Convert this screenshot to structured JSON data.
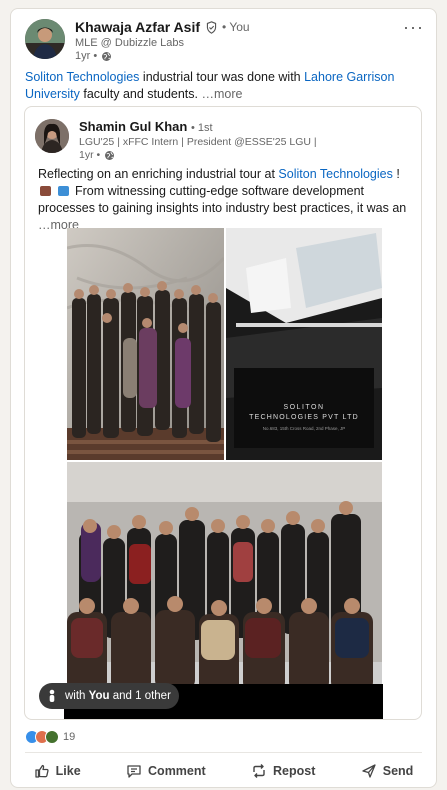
{
  "author": {
    "name": "Khawaja Azfar Asif",
    "you_label": "• You",
    "headline": "MLE @ Dubizzle Labs",
    "time": "1yr •"
  },
  "post": {
    "link1": "Soliton Technologies",
    "text1": " industrial tour was done with ",
    "link2": "Lahore Garrison University",
    "text2": " faculty and students.",
    "more": "…more"
  },
  "shared": {
    "name": "Shamin Gul Khan",
    "degree": "• 1st",
    "headline": "LGU'25 | xFFC Intern | President @ESSE'25 LGU |",
    "time": "1yr •",
    "text_a": "Reflecting on an enriching industrial tour at ",
    "link": "Soliton Technologies",
    "text_b": " ! ",
    "text_c": " From witnessing cutting-edge software development processes to gaining insights into industry best practices, it was an ",
    "more": "…more",
    "sign_line1": "SOLITON",
    "sign_line2": "TECHNOLOGIES PVT LTD",
    "sign_line3": "No.683, 15th Cross Road, 2nd Phase, JP",
    "tag_with": "with ",
    "tag_you": "You",
    "tag_rest": " and 1 other"
  },
  "reactions": {
    "count": "19"
  },
  "actions": {
    "like": "Like",
    "comment": "Comment",
    "repost": "Repost",
    "send": "Send"
  },
  "colors": {
    "link": "#0a66c2",
    "like": "#378fe9",
    "celebrate": "#44712e",
    "love": "#df704d"
  }
}
